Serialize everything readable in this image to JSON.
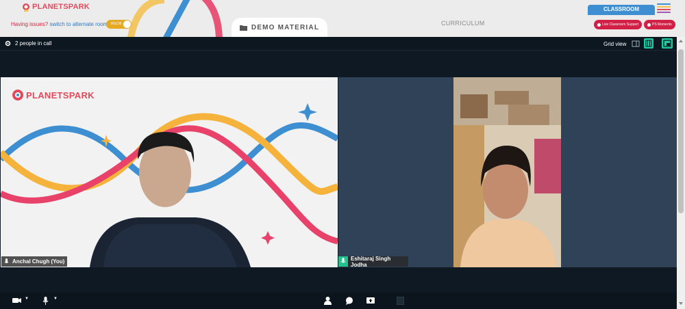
{
  "header": {
    "logo_text_planet": "PLANET",
    "logo_text_spark": "SPARK",
    "issues_question": "Having issues?",
    "issues_link": "switch to alternate room",
    "toggle_label": "RGCM",
    "demo_material_label": "DEMO MATERIAL",
    "curriculum_label": "CURRICULUM",
    "classroom_label": "CLASSROOM",
    "live_support_label": "Live Classroom Support",
    "ps_moments_label": "PS Moments"
  },
  "call": {
    "people_count": "2 people in call",
    "grid_view_label": "Grid view",
    "participants": [
      {
        "name": "Anchal Chugh (You)"
      },
      {
        "name": "Eshitaraj Singh Jodha"
      }
    ],
    "slide_logo": "PLANETSPARK"
  },
  "colors": {
    "brand_red": "#e24a5b",
    "accent_teal": "#22c9a0",
    "classroom_blue": "#3d8fd1",
    "pill_red": "#d21f45",
    "call_bg": "#0f1923"
  }
}
